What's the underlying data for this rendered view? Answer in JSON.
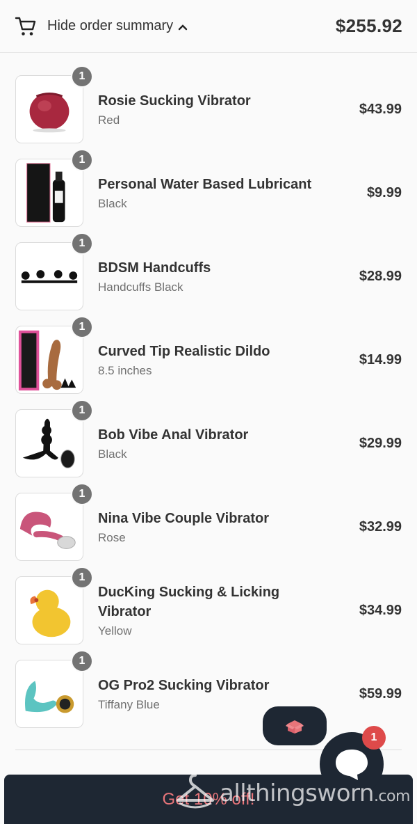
{
  "header": {
    "toggle_label": "Hide order summary",
    "total": "$255.92",
    "icons": {
      "cart": "cart-icon",
      "chevron": "chevron-up-icon"
    }
  },
  "items": [
    {
      "qty": "1",
      "name": "Rosie Sucking Vibrator",
      "variant": "Red",
      "price": "$43.99"
    },
    {
      "qty": "1",
      "name": "Personal Water Based Lubricant",
      "variant": "Black",
      "price": "$9.99"
    },
    {
      "qty": "1",
      "name": "BDSM Handcuffs",
      "variant": "Handcuffs Black",
      "price": "$28.99"
    },
    {
      "qty": "1",
      "name": "Curved Tip Realistic Dildo",
      "variant": "8.5 inches",
      "price": "$14.99"
    },
    {
      "qty": "1",
      "name": "Bob Vibe Anal Vibrator",
      "variant": "Black",
      "price": "$29.99"
    },
    {
      "qty": "1",
      "name": "Nina Vibe Couple Vibrator",
      "variant": "Rose",
      "price": "$32.99"
    },
    {
      "qty": "1",
      "name": "DucKing Sucking & Licking Vibrator",
      "variant": "Yellow",
      "price": "$34.99"
    },
    {
      "qty": "1",
      "name": "OG Pro2 Sucking Vibrator",
      "variant": "Tiffany Blue",
      "price": "$59.99"
    }
  ],
  "widgets": {
    "gift_icon": "gift-box-icon",
    "chat_icon": "chat-bubble-icon",
    "chat_badge": "1"
  },
  "promo": {
    "text": "Get 10% off!"
  },
  "watermark": {
    "name": "allthingsworn",
    "suffix": ".com",
    "icon": "hanger-icon"
  },
  "colors": {
    "dark": "#1e2733",
    "badge_gray": "#737373",
    "notif_red": "#de4a4a",
    "promo_pink": "#e8757a"
  }
}
